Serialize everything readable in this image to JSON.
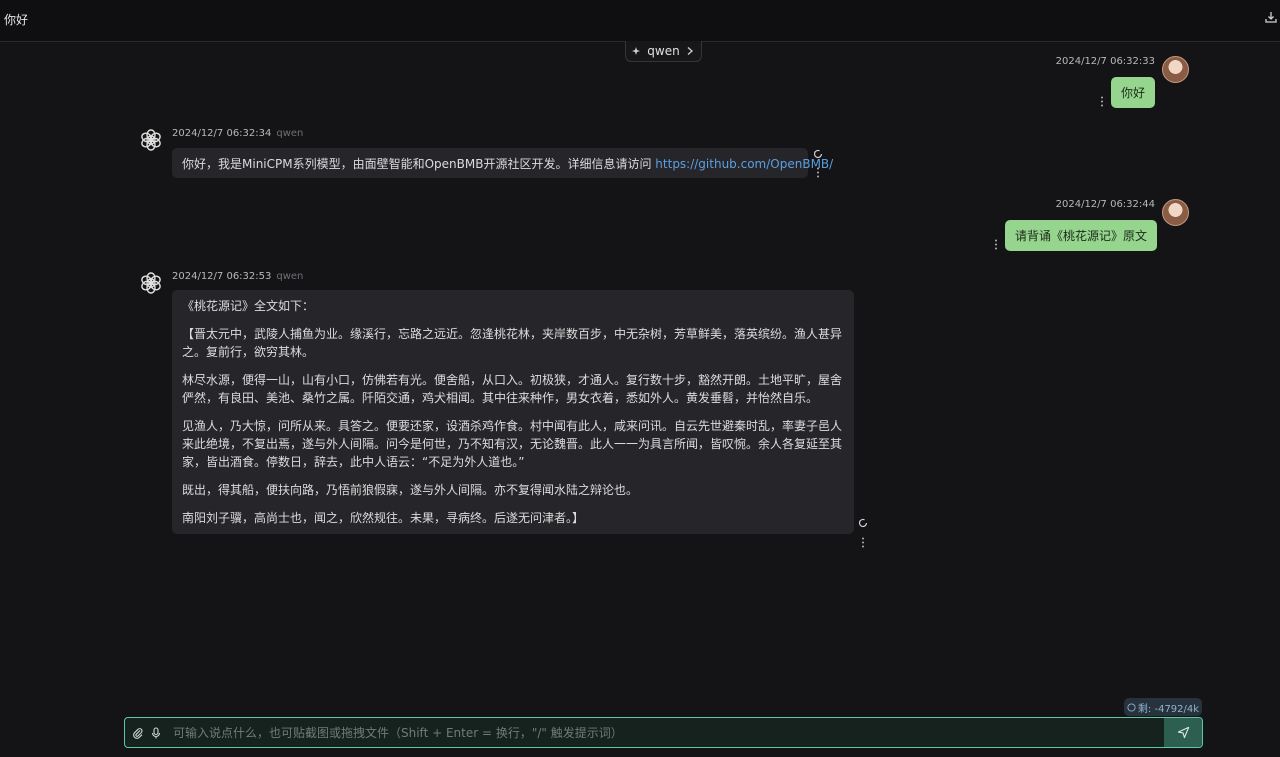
{
  "topbar": {
    "title": "你好"
  },
  "model_chip": {
    "label": "qwen"
  },
  "messages": [
    {
      "role": "user",
      "time": "2024/12/7 06:32:33",
      "text": "你好"
    },
    {
      "role": "assistant",
      "time": "2024/12/7 06:32:34",
      "model": "qwen",
      "text": "你好，我是MiniCPM系列模型，由面壁智能和OpenBMB开源社区开发。详细信息请访问 ",
      "link": "https://github.com/OpenBMB/"
    },
    {
      "role": "user",
      "time": "2024/12/7 06:32:44",
      "text": "请背诵《桃花源记》原文"
    },
    {
      "role": "assistant",
      "time": "2024/12/7 06:32:53",
      "model": "qwen",
      "paragraphs": [
        "《桃花源记》全文如下：",
        "【晋太元中，武陵人捕鱼为业。缘溪行，忘路之远近。忽逢桃花林，夹岸数百步，中无杂树，芳草鲜美，落英缤纷。渔人甚异之。复前行，欲穷其林。",
        "林尽水源，便得一山，山有小口，仿佛若有光。便舍船，从口入。初极狭，才通人。复行数十步，豁然开朗。土地平旷，屋舍俨然，有良田、美池、桑竹之属。阡陌交通，鸡犬相闻。其中往来种作，男女衣着，悉如外人。黄发垂髫，并怡然自乐。",
        "见渔人，乃大惊，问所从来。具答之。便要还家，设酒杀鸡作食。村中闻有此人，咸来问讯。自云先世避秦时乱，率妻子邑人来此绝境，不复出焉，遂与外人间隔。问今是何世，乃不知有汉，无论魏晋。此人一一为具言所闻，皆叹惋。余人各复延至其家，皆出酒食。停数日，辞去，此中人语云：“不足为外人道也。”",
        "既出，得其船，便扶向路，乃悟前狼假寐，遂与外人间隔。亦不复得闻水陆之辩论也。",
        "南阳刘子骥，高尚士也，闻之，欣然规往。未果，寻病终。后遂无问津者。】"
      ]
    }
  ],
  "composer": {
    "placeholder": "可输入说点什么，也可贴截图或拖拽文件（Shift + Enter = 换行，\"/\" 触发提示词）",
    "counter": "剩: -4792/4k"
  },
  "icons": {
    "export": "export-icon",
    "sparkle": "sparkle-icon",
    "chevron": "chevron-right-icon",
    "openai": "openai-logo-icon",
    "more": "more-vertical-icon",
    "refresh": "refresh-icon",
    "attach": "paperclip-icon",
    "mic": "microphone-icon",
    "send": "send-icon",
    "counter": "circle-dollar-icon"
  },
  "colors": {
    "user_bubble": "#95d58d",
    "ai_bubble": "#26262a",
    "accent": "#5ec7a3",
    "link": "#5b9fe0"
  }
}
